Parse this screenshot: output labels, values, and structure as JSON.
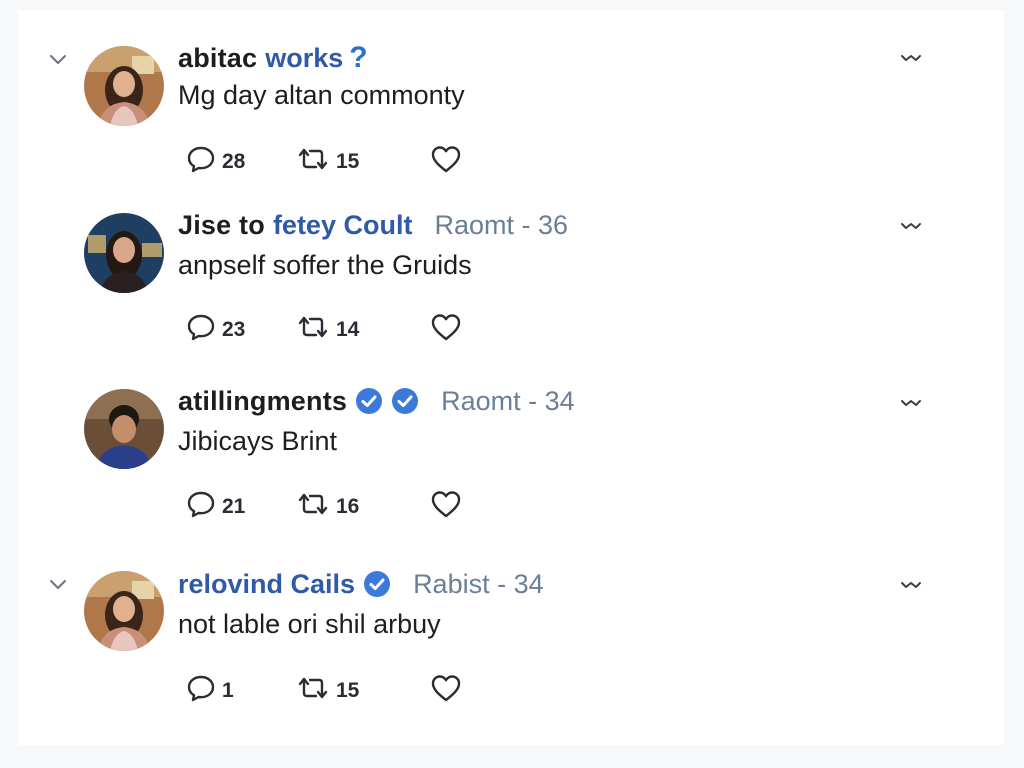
{
  "colors": {
    "name_text": "#1c1e21",
    "name_blue": "#2f5aa8",
    "meta_text": "#6b7f97",
    "verified": "#3b7ad8"
  },
  "posts": [
    {
      "name_black": "abitac",
      "name_blue": "works",
      "name_suffix": "?",
      "meta": "",
      "verified_badges": 0,
      "text": "Mg day altan commonty",
      "replies": "28",
      "retweets": "15",
      "collapse_icon": "chevron-down-icon"
    },
    {
      "name_black": "Jise to",
      "name_blue": "fetey Coult",
      "meta": "Raomt - 36",
      "verified_badges": 0,
      "text": "anpself soffer the Gruids",
      "replies": "23",
      "retweets": "14"
    },
    {
      "name_black": "atillingments",
      "meta": "Raomt - 34",
      "verified_badges": 2,
      "text": "Jibicays Brint",
      "replies": "21",
      "retweets": "16"
    },
    {
      "name_blue": "relovind Cails",
      "meta": "Rabist - 34",
      "verified_badges": 1,
      "text": "not lable ori shil arbuy",
      "replies": "1",
      "retweets": "15",
      "collapse_icon": "chevron-down-icon"
    }
  ]
}
